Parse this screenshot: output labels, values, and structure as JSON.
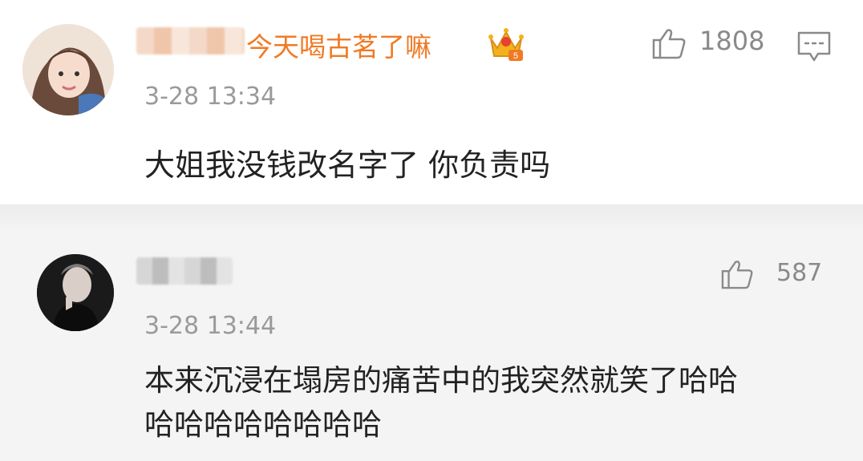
{
  "comments": [
    {
      "username_visible": "今天喝古茗了嘛",
      "badge": "crown-level-5-icon",
      "timestamp": "3-28 13:34",
      "like_count": "1808",
      "text": "大姐我没钱改名字了 你负责吗"
    },
    {
      "timestamp": "3-28 13:44",
      "like_count": "587",
      "text_lines": [
        "本来沉浸在塌房的痛苦中的我突然就笑了哈哈",
        "哈哈哈哈哈哈哈哈"
      ]
    }
  ],
  "colors": {
    "username": "#f07a23",
    "meta": "#9a9a9a",
    "body": "#222222"
  }
}
